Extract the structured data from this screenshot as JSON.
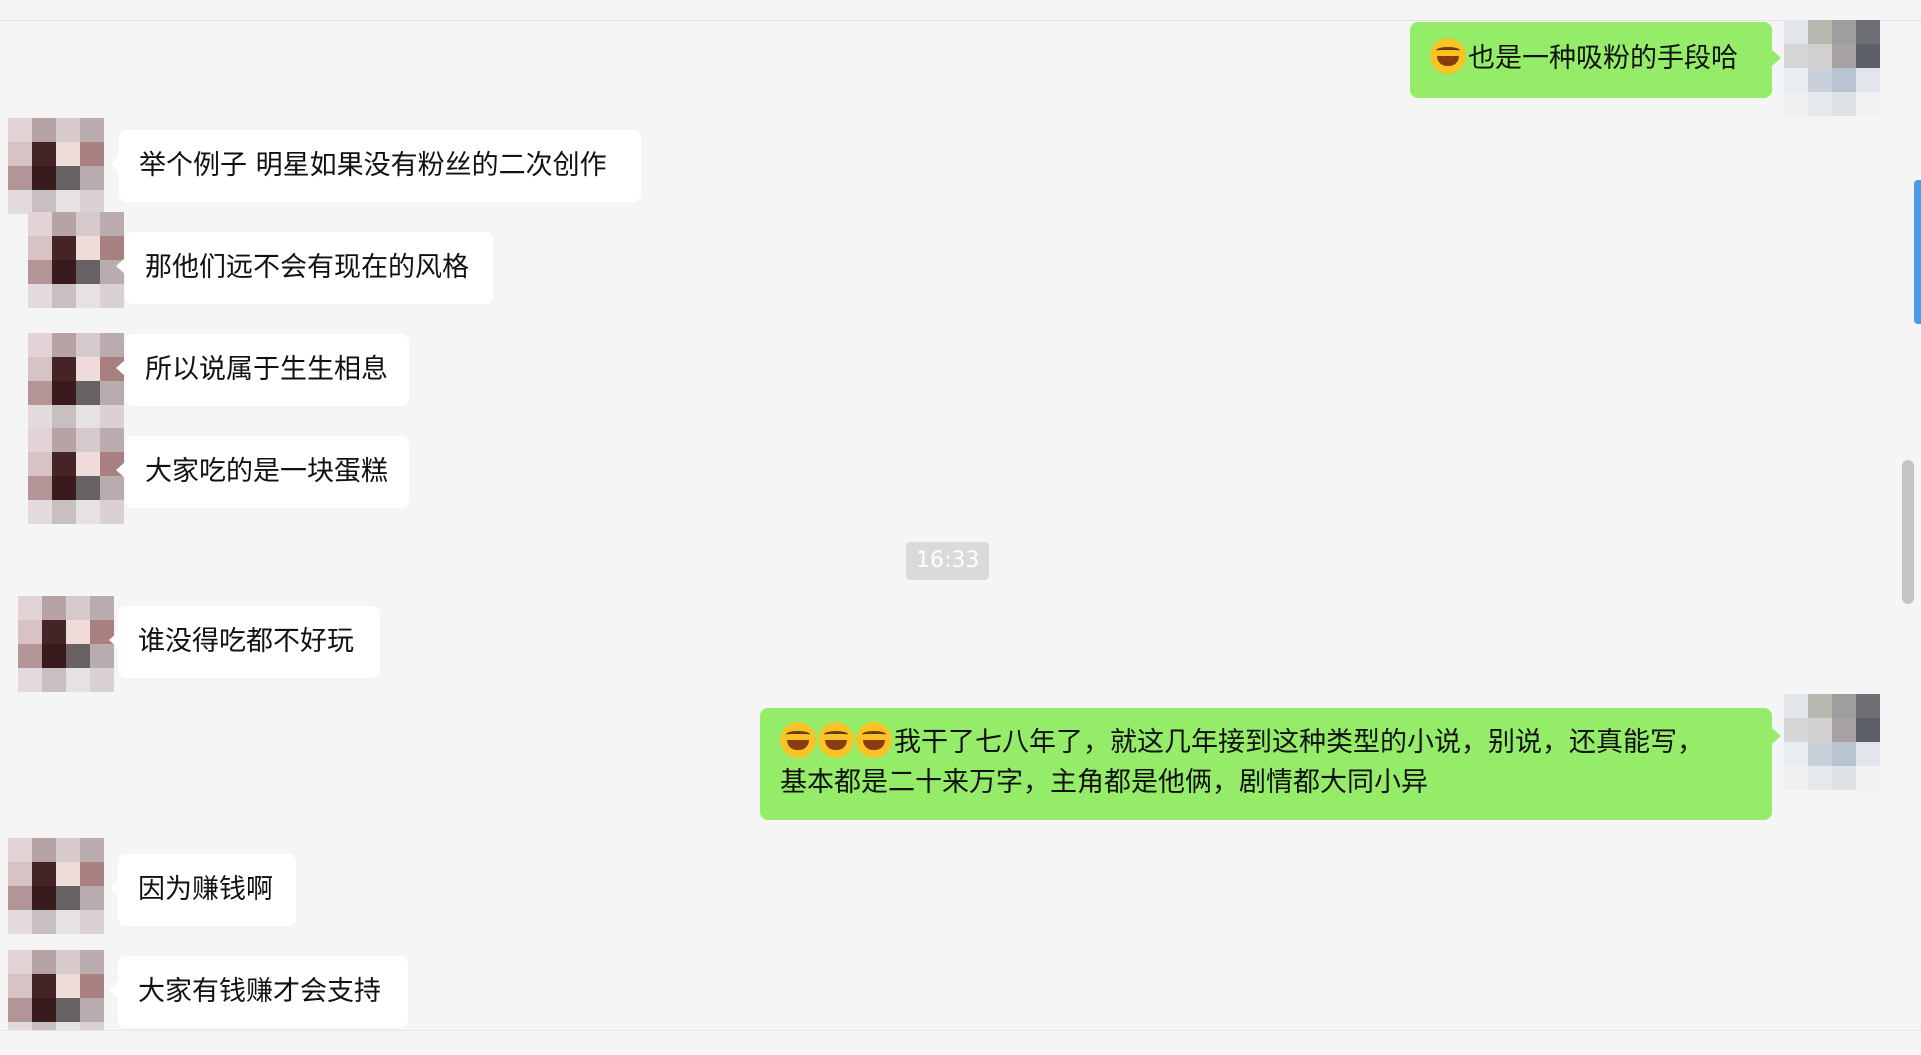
{
  "messages": [
    {
      "direction": "out",
      "text": "也是一种吸粉的手段哈",
      "emoji_prefix": [
        "tears-of-joy-emoji"
      ]
    },
    {
      "direction": "in",
      "text": "举个例子 明星如果没有粉丝的二次创作"
    },
    {
      "direction": "in",
      "text": "那他们远不会有现在的风格"
    },
    {
      "direction": "in",
      "text": "所以说属于生生相息"
    },
    {
      "direction": "in",
      "text": "大家吃的是一块蛋糕"
    },
    {
      "direction": "in",
      "text": "谁没得吃都不好玩"
    },
    {
      "direction": "out",
      "line1": "我干了七八年了，就这几年接到这种类型的小说，别说，还真能写，",
      "line2": "基本都是二十来万字，主角都是他俩，剧情都大同小异",
      "emoji_prefix": [
        "rolling-laughing-emoji",
        "rolling-laughing-emoji",
        "rolling-laughing-emoji"
      ]
    },
    {
      "direction": "in",
      "text": "因为赚钱啊"
    },
    {
      "direction": "in",
      "text": "大家有钱赚才会支持"
    }
  ],
  "timestamp": "16:33",
  "colors": {
    "background": "#f5f5f5",
    "incoming_bubble": "#ffffff",
    "outgoing_bubble": "#95ec69",
    "timestamp_bg": "#dadada"
  },
  "avatars": {
    "left": [
      "#e2d4d6",
      "#b7a3a5",
      "#d6cacc",
      "#b9abae",
      "#d8c3c4",
      "#452428",
      "#efdcda",
      "#a98080",
      "#b49597",
      "#3a1b1d",
      "#696264",
      "#b8acae",
      "#e2dadc",
      "#c8bfc1",
      "#e6e2e3",
      "#d9d1d3"
    ],
    "right": [
      "#e3e6ea",
      "#b8b8b0",
      "#9e9e9e",
      "#6d6f74",
      "#d7d6d6",
      "#d2d0cf",
      "#a8a2a4",
      "#5e6068",
      "#e9eef2",
      "#c9d0da",
      "#b8c4d2",
      "#e2e6ec",
      "#f0f0f0",
      "#e5e8ec",
      "#dde2e7",
      "#f2f2f2"
    ]
  }
}
